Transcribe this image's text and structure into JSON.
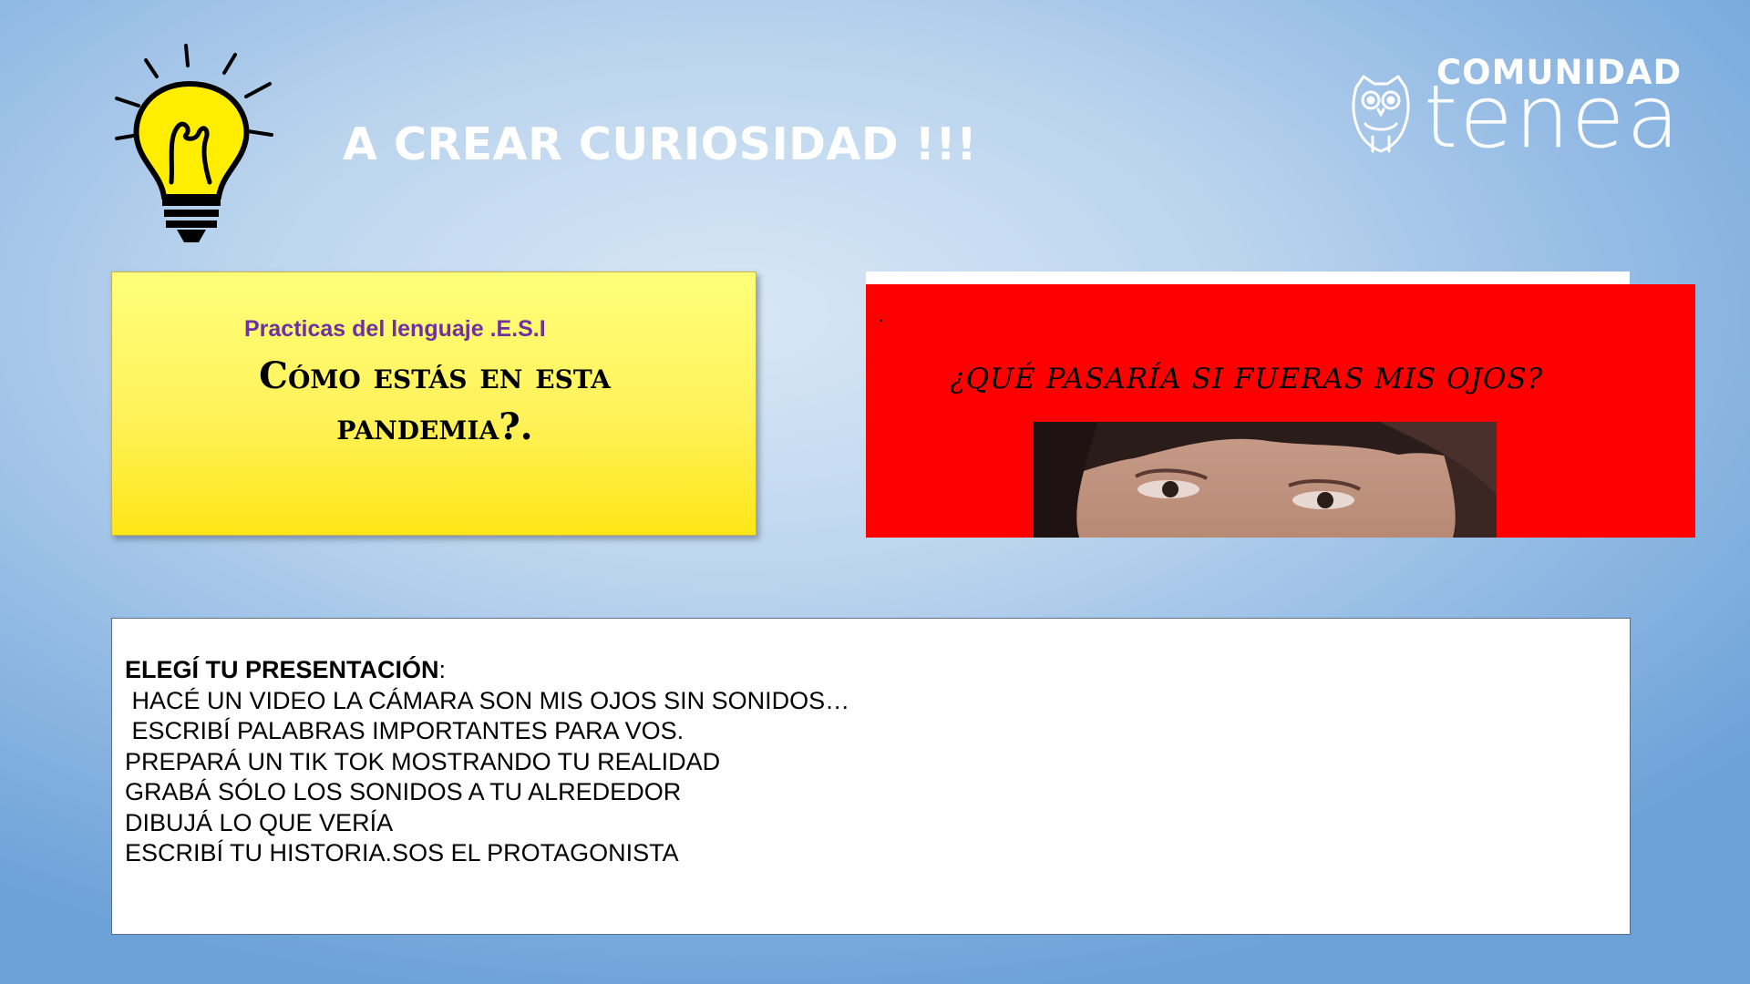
{
  "slide": {
    "title": "A CREAR CURIOSIDAD !!!"
  },
  "logo": {
    "top_text": "COMUNIDAD",
    "main_text": "tenea"
  },
  "yellow_card": {
    "subject": "Practicas del lenguaje  .E.S.I",
    "question_line1": "Cómo estás en esta",
    "question_line2": "pandemia?."
  },
  "red_card": {
    "dot": ".",
    "question": "¿QUÉ PASARÍA SI FUERAS MIS OJOS?"
  },
  "presentation": {
    "heading": "ELEGÍ TU PRESENTACIÓN",
    "heading_suffix": ":",
    "options": [
      " HACÉ UN VIDEO LA CÁMARA SON MIS OJOS SIN SONIDOS…",
      " ESCRIBÍ PALABRAS IMPORTANTES PARA VOS.",
      "PREPARÁ UN TIK TOK MOSTRANDO TU REALIDAD",
      "GRABÁ SÓLO LOS SONIDOS A TU ALREDEDOR",
      "DIBUJÁ LO QUE VERÍA",
      "ESCRIBÍ TU HISTORIA.SOS EL PROTAGONISTA"
    ]
  },
  "colors": {
    "bulb_yellow": "#ffee00",
    "subject_purple": "#7030a0",
    "red_panel": "#ff0000"
  },
  "icons": {
    "bulb": "lightbulb-icon",
    "owl": "owl-icon"
  }
}
